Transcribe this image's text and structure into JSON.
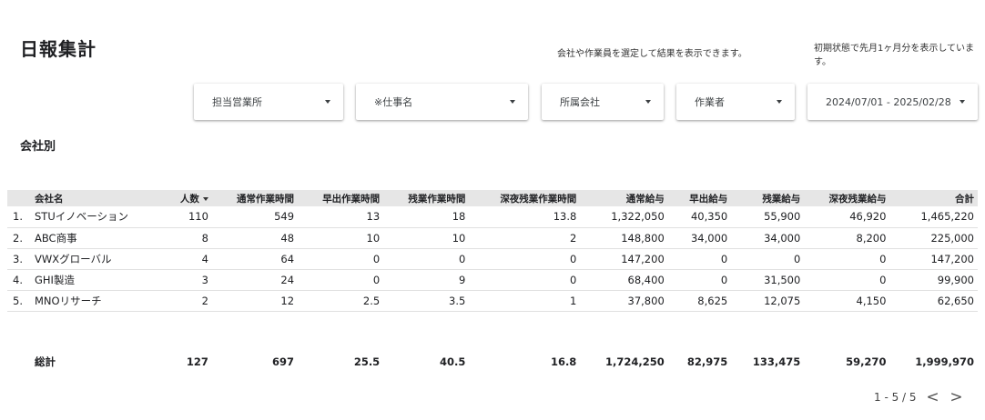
{
  "header": {
    "title": "日報集計",
    "info_left": "会社や作業員を選定して結果を表示できます。",
    "info_right": "初期状態で先月1ヶ月分を表示しています。"
  },
  "filters": [
    {
      "label": "担当営業所"
    },
    {
      "label": "※仕事名"
    },
    {
      "label": "所属会社"
    },
    {
      "label": "作業者"
    },
    {
      "label": "2024/07/01 - 2025/02/28"
    }
  ],
  "section": {
    "title": "会社別"
  },
  "table": {
    "columns": [
      "会社名",
      "人数",
      "通常作業時間",
      "早出作業時間",
      "残業作業時間",
      "深夜残業作業時間",
      "通常給与",
      "早出給与",
      "残業給与",
      "深夜残業給与",
      "合計"
    ],
    "rows": [
      {
        "rank": "1.",
        "cells": [
          "STUイノベーション",
          "110",
          "549",
          "13",
          "18",
          "13.8",
          "1,322,050",
          "40,350",
          "55,900",
          "46,920",
          "1,465,220"
        ]
      },
      {
        "rank": "2.",
        "cells": [
          "ABC商事",
          "8",
          "48",
          "10",
          "10",
          "2",
          "148,800",
          "34,000",
          "34,000",
          "8,200",
          "225,000"
        ]
      },
      {
        "rank": "3.",
        "cells": [
          "VWXグローバル",
          "4",
          "64",
          "0",
          "0",
          "0",
          "147,200",
          "0",
          "0",
          "0",
          "147,200"
        ]
      },
      {
        "rank": "4.",
        "cells": [
          "GHI製造",
          "3",
          "24",
          "0",
          "9",
          "0",
          "68,400",
          "0",
          "31,500",
          "0",
          "99,900"
        ]
      },
      {
        "rank": "5.",
        "cells": [
          "MNOリサーチ",
          "2",
          "12",
          "2.5",
          "3.5",
          "1",
          "37,800",
          "8,625",
          "12,075",
          "4,150",
          "62,650"
        ]
      }
    ],
    "total": [
      "総計",
      "127",
      "697",
      "25.5",
      "40.5",
      "16.8",
      "1,724,250",
      "82,975",
      "133,475",
      "59,270",
      "1,999,970"
    ]
  },
  "pager": {
    "range": "1 - 5 / 5",
    "prev": "<",
    "next": ">"
  }
}
